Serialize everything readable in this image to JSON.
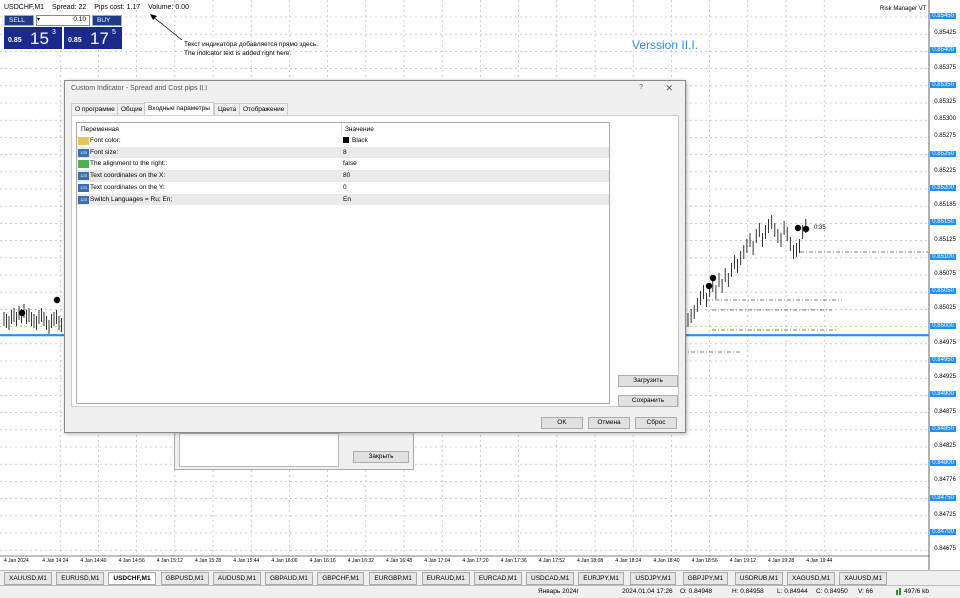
{
  "chart": {
    "symbol": "USDCHF,M1",
    "spread": "Spread: 22",
    "pips_cost": "Pips cost: 1.17",
    "volume": "Volume: 0.00",
    "risk_manager": "Risk Manager VT",
    "version": "Verssion II.I.",
    "annotation_ru": "Текст индикатора добавляется прямо здесь.",
    "annotation_en": "The indicator text is added right here.",
    "timer": "0:35",
    "prices": [
      "0.85450",
      "0.85425",
      "0.85400",
      "0.85375",
      "0.85350",
      "0.85325",
      "0.85300",
      "0.85275",
      "0.85250",
      "0.85225",
      "0.85200",
      "0.85185",
      "0.85150",
      "0.85125",
      "0.85100",
      "0.85075",
      "0.85050",
      "0.85025",
      "0.85000",
      "0.84975",
      "0.84950",
      "0.84925",
      "0.84900",
      "0.84875",
      "0.84850",
      "0.84825",
      "0.84800",
      "0.84776",
      "0.84750",
      "0.84725",
      "0.84700",
      "0.84675"
    ],
    "highlighted_prices": [
      "0.85450",
      "0.85400",
      "0.85350",
      "0.85250",
      "0.85200",
      "0.85150",
      "0.85100",
      "0.85050",
      "0.85000",
      "0.84950",
      "0.84900",
      "0.84850",
      "0.84800",
      "0.84750",
      "0.84700"
    ],
    "times": [
      "4 Jan 2024",
      "4 Jan 14:24",
      "4 Jan 14:40",
      "4 Jan 14:56",
      "4 Jan 15:12",
      "4 Jan 15:28",
      "4 Jan 15:44",
      "4 Jan 16:00",
      "4 Jan 16:16",
      "4 Jan 16:32",
      "4 Jan 16:48",
      "4 Jan 17:04",
      "4 Jan 17:20",
      "4 Jan 17:36",
      "4 Jan 17:52",
      "4 Jan 18:08",
      "4 Jan 18:24",
      "4 Jan 18:40",
      "4 Jan 18:56",
      "4 Jan 19:12",
      "4 Jan 19:28",
      "4 Jan 19:44"
    ],
    "colors": {
      "accent": "#1e90ff",
      "grid": "#9bb3c9",
      "version": "#2b8fd8",
      "price_panel": "#1a2a8a"
    }
  },
  "trade_panel": {
    "sell_label": "SELL",
    "buy_label": "BUY",
    "lot": "0.10",
    "lot_arrow": "▾",
    "sell_small": "0.85",
    "sell_big": "15",
    "sell_sup": "3",
    "buy_small": "0.85",
    "buy_big": "17",
    "buy_sup": "5"
  },
  "dialog": {
    "title": "Custom Indicator - Spread and Cost pips II.I",
    "help": "?",
    "close": "✕",
    "tabs": [
      "О программе",
      "Общие",
      "Входные параметры",
      "Цвета",
      "Отображение"
    ],
    "active_tab": 2,
    "col_variable": "Переменная",
    "col_value": "Значение",
    "params": [
      {
        "icon": "color",
        "name": "Font color:",
        "value": "Black"
      },
      {
        "icon": "num",
        "name": "Font size:",
        "value": "8"
      },
      {
        "icon": "bool",
        "name": "The alignment to the right::",
        "value": "false"
      },
      {
        "icon": "num",
        "name": "Text coordinates on the X:",
        "value": "80"
      },
      {
        "icon": "num",
        "name": "Text coordinates on the Y:",
        "value": "0"
      },
      {
        "icon": "num",
        "name": "Switch Languages = Ru; En;",
        "value": "En"
      }
    ],
    "icon_text": "123",
    "load_label": "Загрузить",
    "save_label": "Сохранить",
    "ok_label": "OK",
    "cancel_label": "Отмена",
    "reset_label": "Сброс"
  },
  "behind_dialog": {
    "close_label": "Закрыть"
  },
  "symbol_tabs": [
    "XAUUSD,M1",
    "EURUSD,M1",
    "USDCHF,M1",
    "GBPUSD,M1",
    "AUDUSD,M1",
    "GBPAUD,M1",
    "GBPCHF,M1",
    "EURGBP,M1",
    "EURAUD,M1",
    "EURCAD,M1",
    "USDCAD,M1",
    "EURJPY,M1",
    "USDJPY,M1",
    "GBPJPY,M1",
    "USDRUB,M1",
    "XAGUSD,M1",
    "XAUUSD,M1"
  ],
  "active_symbol_tab": 2,
  "status": {
    "month": "Январь 2024г",
    "datetime": "2024.01.04 17:26",
    "open": "O: 0.84948",
    "high": "H: 0.84958",
    "low": "L: 0.84944",
    "close": "C: 0.84950",
    "vol": "V: 66",
    "traffic": "497/6 kb"
  }
}
